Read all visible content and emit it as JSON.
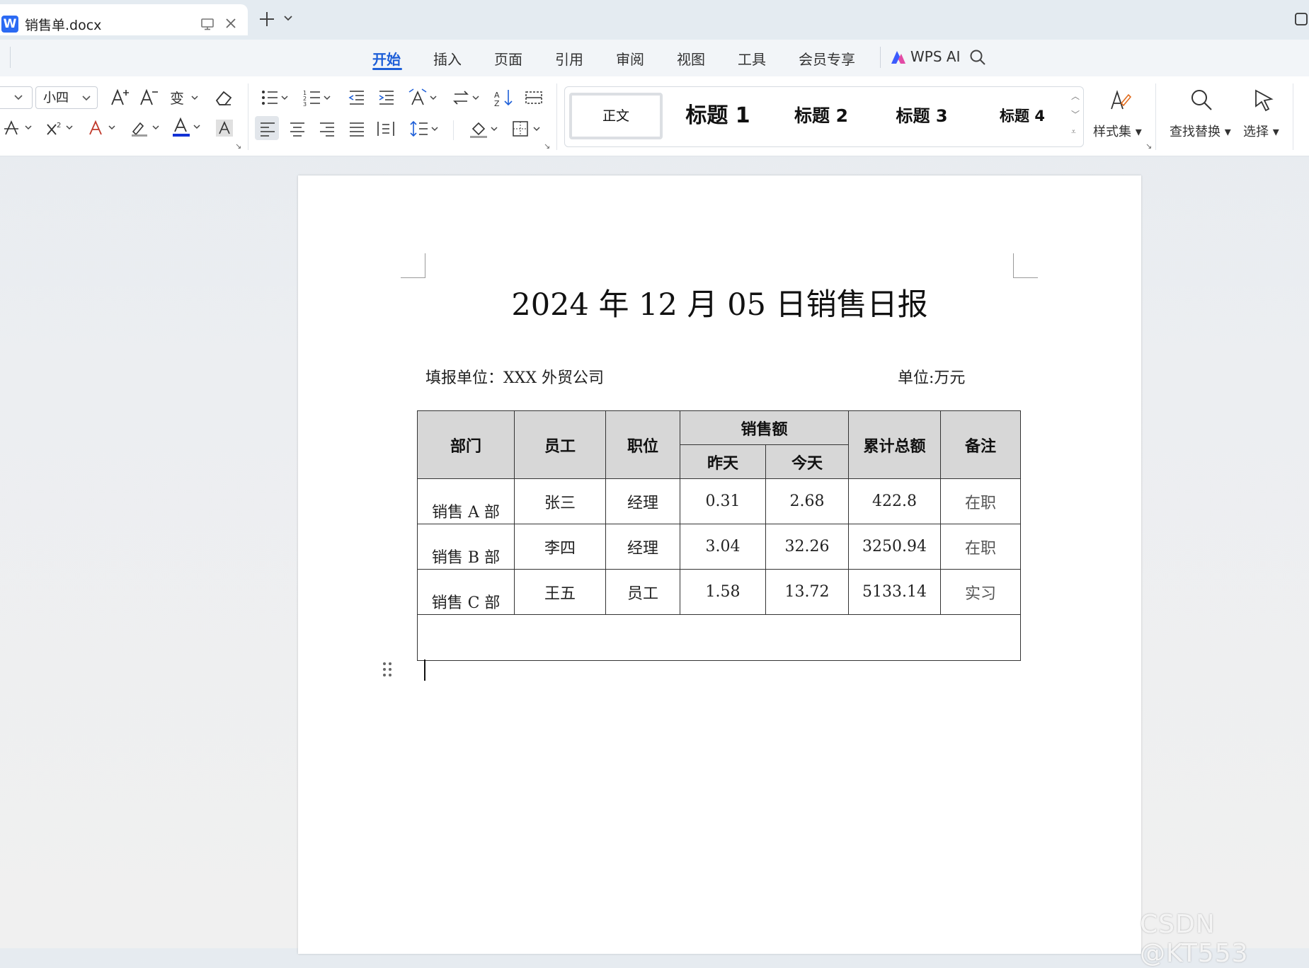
{
  "titlebar": {
    "tab_title": "销售单.docx",
    "app_logo": "W"
  },
  "menu": {
    "items": [
      "开始",
      "插入",
      "页面",
      "引用",
      "审阅",
      "视图",
      "工具",
      "会员专享"
    ],
    "ai_label": "WPS AI"
  },
  "ribbon": {
    "font_size": "小四",
    "styles": [
      "正文",
      "标题 1",
      "标题 2",
      "标题 3",
      "标题 4"
    ],
    "style_set_label": "样式集",
    "find_replace_label": "查找替换",
    "select_label": "选择"
  },
  "document": {
    "title": "2024 年 12 月 05 日销售日报",
    "fill_unit": "填报单位：XXX 外贸公司",
    "money_unit": "单位:万元",
    "table": {
      "headers": {
        "dept": "部门",
        "employee": "员工",
        "position": "职位",
        "sales": "销售额",
        "yesterday": "昨天",
        "today": "今天",
        "total": "累计总额",
        "note": "备注"
      },
      "rows": [
        {
          "dept": "销售 A 部",
          "employee": "张三",
          "position": "经理",
          "yesterday": "0.31",
          "today": "2.68",
          "total": "422.8",
          "note": "在职"
        },
        {
          "dept": "销售 B 部",
          "employee": "李四",
          "position": "经理",
          "yesterday": "3.04",
          "today": "32.26",
          "total": "3250.94",
          "note": "在职"
        },
        {
          "dept": "销售 C 部",
          "employee": "王五",
          "position": "员工",
          "yesterday": "1.58",
          "today": "13.72",
          "total": "5133.14",
          "note": "实习"
        }
      ]
    }
  },
  "watermark": "CSDN @KT553"
}
